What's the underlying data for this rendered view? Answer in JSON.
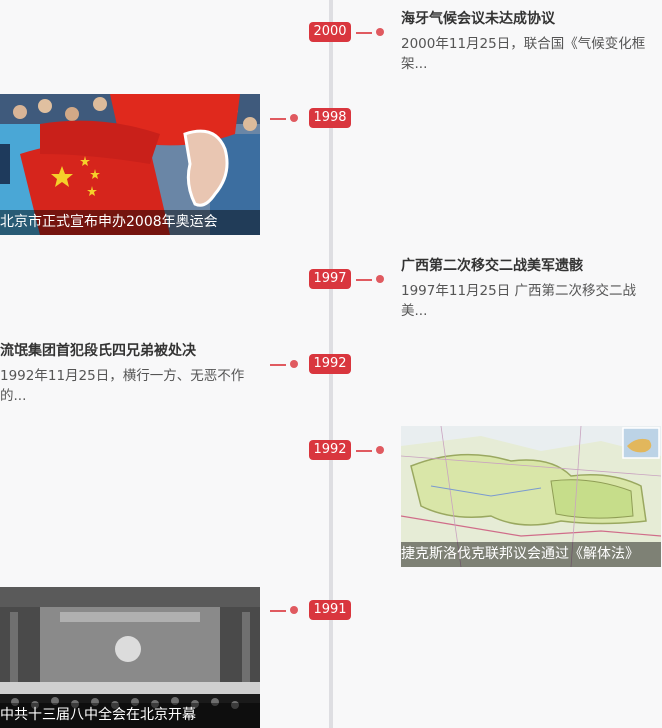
{
  "timeline": {
    "events": [
      {
        "year": "2000",
        "title": "海牙气候会议未达成协议",
        "summary": "2000年11月25日，联合国《气候变化框架..."
      },
      {
        "year": "1998",
        "caption": "北京市正式宣布申办2008年奥运会"
      },
      {
        "year": "1997",
        "title": "广西第二次移交二战美军遗骸",
        "summary": "1997年11月25日 广西第二次移交二战美..."
      },
      {
        "year": "1992",
        "title": "流氓集团首犯段氏四兄弟被处决",
        "summary": "1992年11月25日，横行一方、无恶不作的..."
      },
      {
        "year": "1992",
        "caption": "捷克斯洛伐克联邦议会通过《解体法》"
      },
      {
        "year": "1991",
        "caption": "中共十三届八中全会在北京开幕"
      }
    ]
  },
  "colors": {
    "accent": "#d9363e",
    "axis": "#dedee2",
    "background": "#f8f8f9"
  }
}
